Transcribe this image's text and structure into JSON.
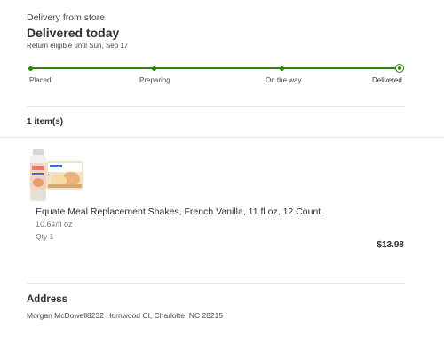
{
  "header": {
    "subtitle": "Delivery from store",
    "title": "Delivered today",
    "return_note": "Return eligible until Sun, Sep 17"
  },
  "progress": {
    "color": "#2a8703",
    "steps": [
      {
        "label": "Placed"
      },
      {
        "label": "Preparing"
      },
      {
        "label": "On the way"
      },
      {
        "label": "Delivered"
      }
    ],
    "current_step": 4
  },
  "items": {
    "count_label": "1 item(s)",
    "list": [
      {
        "name": "Equate Meal Replacement Shakes, French Vanilla, 11 fl oz, 12 Count",
        "unit_price": "10.6¢/fl oz",
        "quantity": "Qty 1",
        "price": "$13.98",
        "image_icon": "product-image"
      }
    ]
  },
  "address": {
    "heading": "Address",
    "line": "Morgan McDowell8232 Hornwood Ct, Charlotte, NC 28215"
  }
}
